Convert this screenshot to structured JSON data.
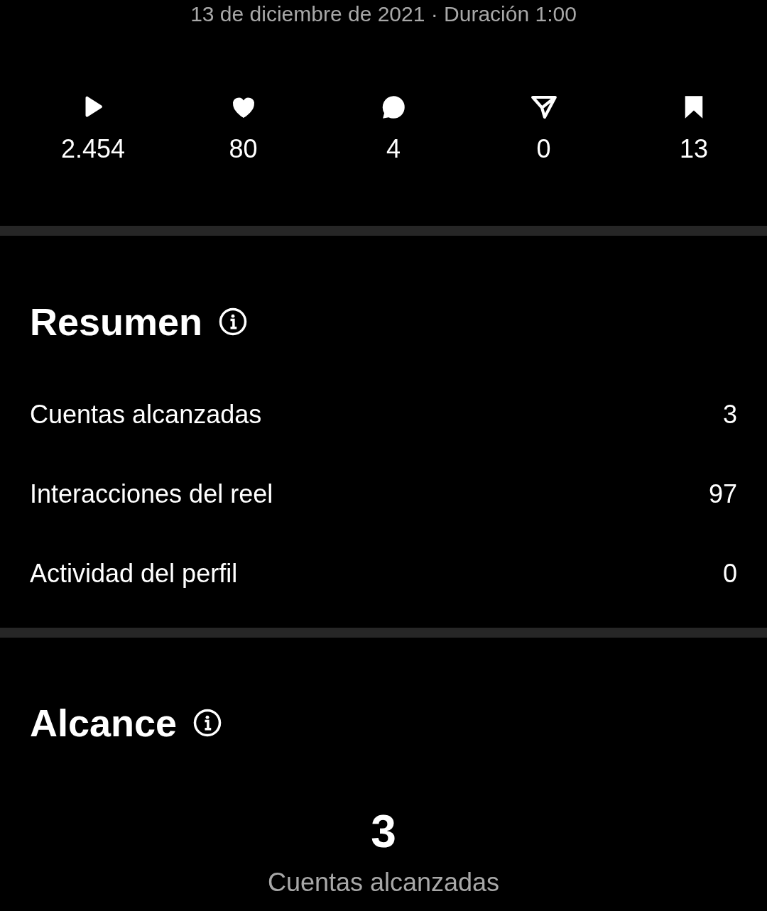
{
  "header": {
    "subtitle": "13 de diciembre de 2021 · Duración 1:00"
  },
  "stats": [
    {
      "kind": "plays",
      "value": "2.454"
    },
    {
      "kind": "likes",
      "value": "80"
    },
    {
      "kind": "comments",
      "value": "4"
    },
    {
      "kind": "shares",
      "value": "0"
    },
    {
      "kind": "saves",
      "value": "13"
    }
  ],
  "summary": {
    "title": "Resumen",
    "rows": [
      {
        "label": "Cuentas alcanzadas",
        "value": "3"
      },
      {
        "label": "Interacciones del reel",
        "value": "97"
      },
      {
        "label": "Actividad del perfil",
        "value": "0"
      }
    ]
  },
  "reach": {
    "title": "Alcance",
    "value": "3",
    "caption": "Cuentas alcanzadas"
  }
}
